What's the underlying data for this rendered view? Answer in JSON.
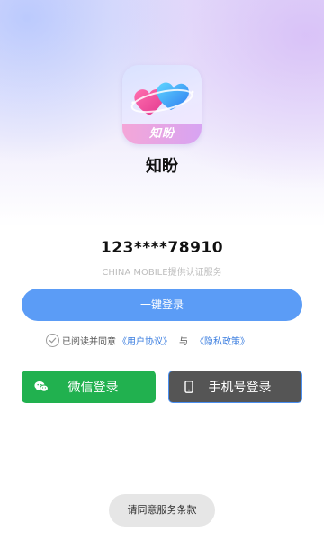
{
  "app": {
    "name": "知盼",
    "icon_label": "知盼"
  },
  "login": {
    "masked_phone": "123****78910",
    "provider_text": "CHINA MOBILE提供认证服务",
    "one_click_label": "一键登录"
  },
  "agreement": {
    "prefix": "已阅读并同意",
    "user_agreement": "《用户协议》",
    "conjunction": "与",
    "privacy_policy": "《隐私政策》",
    "checked": false
  },
  "alt_login": {
    "wechat_label": "微信登录",
    "phone_label": "手机号登录"
  },
  "toast": {
    "text": "请同意服务条款"
  },
  "colors": {
    "primary_blue": "#5b9cf6",
    "wechat_green": "#21b14f",
    "phone_button": "#555555",
    "link_blue": "#3d7fe0"
  }
}
